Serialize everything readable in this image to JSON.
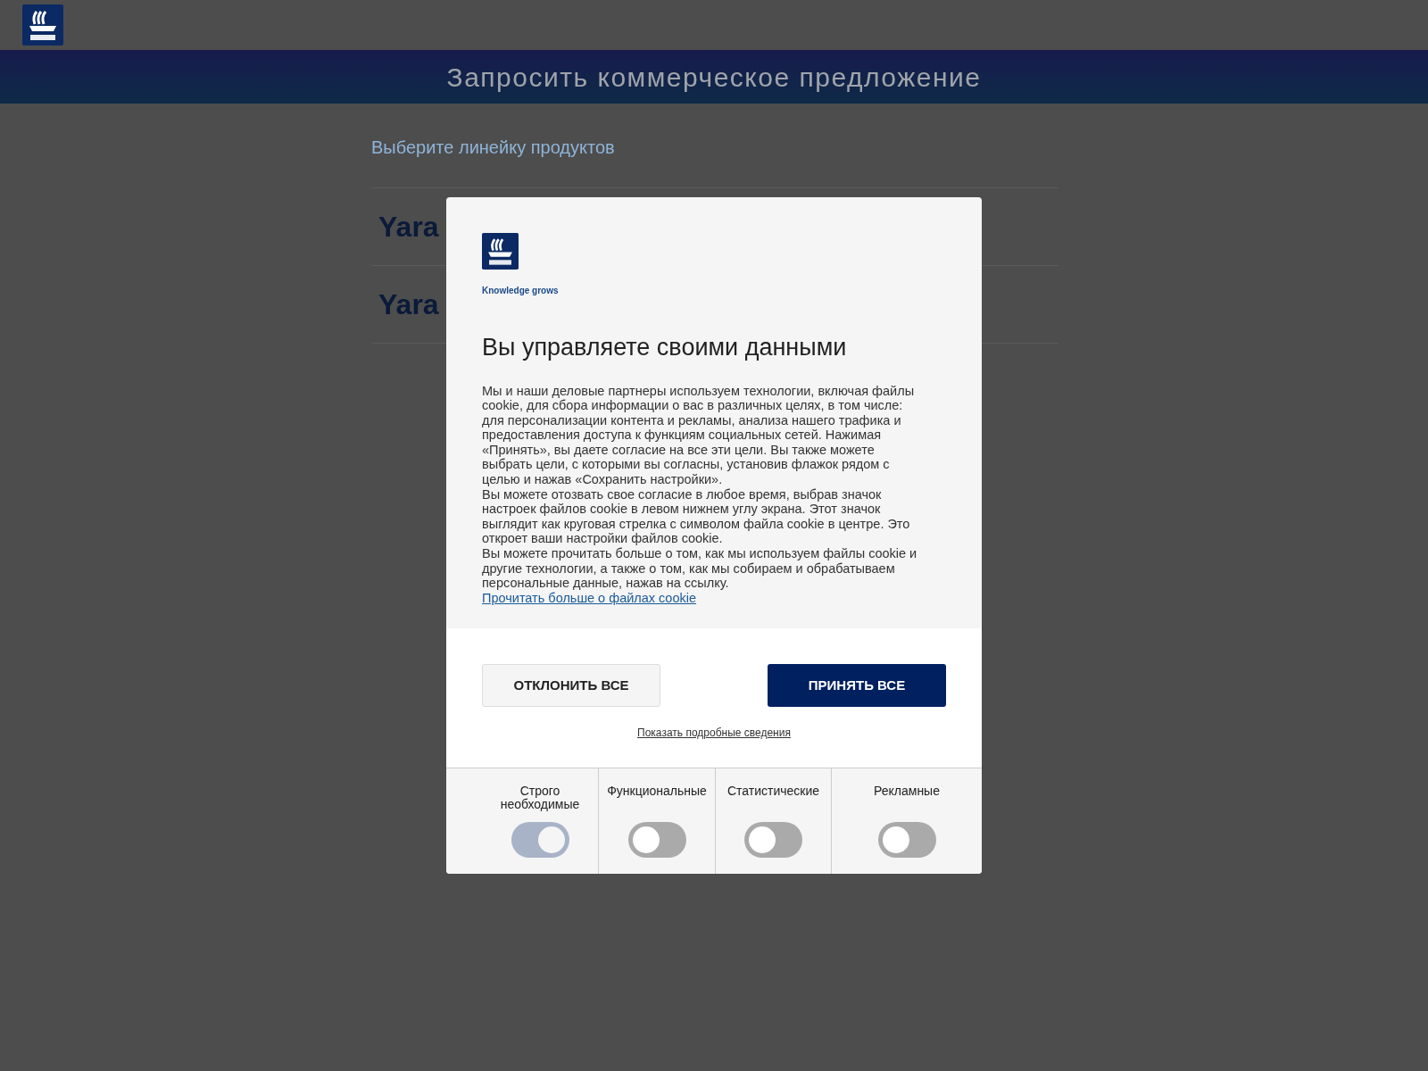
{
  "page": {
    "banner_title": "Запросить коммерческое предложение",
    "section_title": "Выберите линейку продуктов",
    "product_lines": [
      {
        "label": "Yara"
      },
      {
        "label": "Yara"
      }
    ]
  },
  "cookie_dialog": {
    "tagline": "Knowledge grows",
    "title": "Вы управляете своими данными",
    "paragraphs": [
      "Мы и наши деловые партнеры используем технологии, включая файлы cookie, для сбора информации о вас в различных целях, в том числе: для персонализации контента и рекламы, анализа нашего трафика и предоставления доступа к функциям социальных сетей. Нажимая «Принять», вы даете согласие на все эти цели. Вы также можете выбрать цели, с которыми вы согласны, установив флажок рядом с целью и нажав «Сохранить настройки».",
      "Вы можете отозвать свое согласие в любое время, выбрав значок настроек файлов cookie в левом нижнем углу экрана. Этот значок выглядит как круговая стрелка с символом файла cookie в центре. Это откроет ваши настройки файлов cookie.",
      "Вы можете прочитать больше о том, как мы используем файлы cookie и другие технологии, а также о том, как мы собираем и обрабатываем персональные данные, нажав на ссылку."
    ],
    "link": "Прочитать больше о файлах cookie",
    "reject_button": "ОТКЛОНИТЬ ВСЕ",
    "accept_button": "ПРИНЯТЬ ВСЕ",
    "details_link": "Показать подробные сведения",
    "categories": [
      {
        "label": "Строго необходимые",
        "on": true,
        "disabled": true
      },
      {
        "label": "Функциональные",
        "on": false,
        "disabled": false
      },
      {
        "label": "Статистические",
        "on": false,
        "disabled": false
      },
      {
        "label": "Рекламные",
        "on": false,
        "disabled": false
      }
    ]
  }
}
